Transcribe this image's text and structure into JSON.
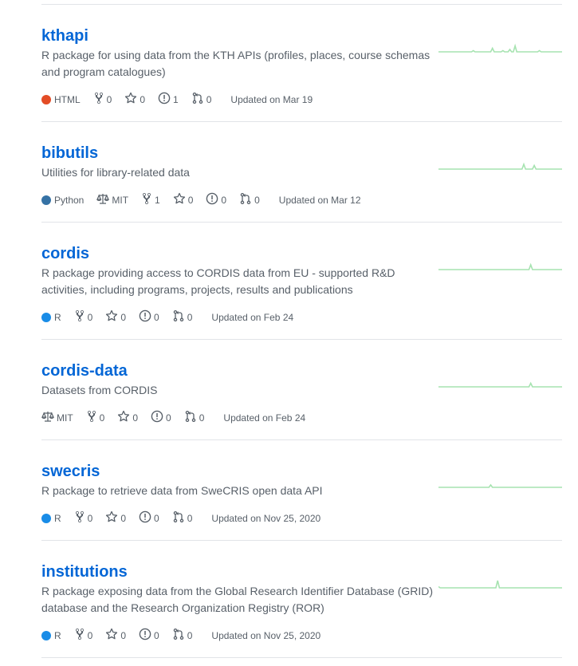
{
  "repos": [
    {
      "name": "kthapi",
      "description": "R package for using data from the KTH APIs (profiles, places, course schemas and program catalogues)",
      "language": "HTML",
      "language_color": "#e34c26",
      "license": null,
      "forks": "0",
      "stars": "0",
      "issues": "1",
      "pulls": "0",
      "updated": "Updated on Mar 19",
      "activity": [
        0,
        0,
        0,
        0,
        0,
        0,
        0,
        0,
        0,
        0,
        0,
        0,
        0,
        0,
        0,
        0,
        0,
        0,
        0,
        0,
        1,
        0,
        0,
        0,
        0,
        0,
        0,
        0,
        0,
        0,
        0,
        3,
        0,
        0,
        0,
        0,
        0,
        1,
        0,
        0,
        0,
        2,
        0,
        0,
        5,
        0,
        0,
        0,
        0,
        0,
        0,
        0,
        0,
        0,
        0,
        0,
        0,
        0,
        1,
        0,
        0,
        0,
        0,
        0,
        0,
        0,
        0,
        0,
        0,
        0,
        0,
        0
      ]
    },
    {
      "name": "bibutils",
      "description": "Utilities for library-related data",
      "language": "Python",
      "language_color": "#3572a5",
      "license": "MIT",
      "forks": "1",
      "stars": "0",
      "issues": "0",
      "pulls": "0",
      "updated": "Updated on Mar 12",
      "activity": [
        0,
        0,
        0,
        0,
        0,
        0,
        0,
        0,
        0,
        0,
        0,
        0,
        0,
        0,
        0,
        0,
        0,
        0,
        0,
        0,
        0,
        0,
        0,
        0,
        0,
        0,
        0,
        0,
        0,
        0,
        0,
        0,
        0,
        0,
        0,
        0,
        0,
        0,
        0,
        0,
        0,
        0,
        0,
        0,
        0,
        0,
        0,
        0,
        0,
        4,
        0,
        0,
        0,
        0,
        0,
        3,
        0,
        0,
        0,
        0,
        0,
        0,
        0,
        0,
        0,
        0,
        0,
        0,
        0,
        0,
        0,
        0
      ]
    },
    {
      "name": "cordis",
      "description": "R package providing access to CORDIS data from EU - supported R&D activities, including programs, projects, results and publications",
      "language": "R",
      "language_color": "#198ce7",
      "license": null,
      "forks": "0",
      "stars": "0",
      "issues": "0",
      "pulls": "0",
      "updated": "Updated on Feb 24",
      "activity": [
        0,
        0,
        0,
        0,
        0,
        0,
        0,
        0,
        0,
        0,
        0,
        0,
        0,
        0,
        0,
        0,
        0,
        0,
        0,
        0,
        0,
        0,
        0,
        0,
        0,
        0,
        0,
        0,
        0,
        0,
        0,
        0,
        0,
        0,
        0,
        0,
        0,
        0,
        0,
        0,
        0,
        0,
        0,
        0,
        0,
        0,
        0,
        0,
        0,
        0,
        0,
        0,
        0,
        4,
        0,
        0,
        0,
        0,
        0,
        0,
        0,
        0,
        0,
        0,
        0,
        0,
        0,
        0,
        0,
        0,
        0,
        0
      ]
    },
    {
      "name": "cordis-data",
      "description": "Datasets from CORDIS",
      "language": null,
      "language_color": null,
      "license": "MIT",
      "forks": "0",
      "stars": "0",
      "issues": "0",
      "pulls": "0",
      "updated": "Updated on Feb 24",
      "activity": [
        0,
        0,
        0,
        0,
        0,
        0,
        0,
        0,
        0,
        0,
        0,
        0,
        0,
        0,
        0,
        0,
        0,
        0,
        0,
        0,
        0,
        0,
        0,
        0,
        0,
        0,
        0,
        0,
        0,
        0,
        0,
        0,
        0,
        0,
        0,
        0,
        0,
        0,
        0,
        0,
        0,
        0,
        0,
        0,
        0,
        0,
        0,
        0,
        0,
        0,
        0,
        0,
        0,
        3,
        0,
        0,
        0,
        0,
        0,
        0,
        0,
        0,
        0,
        0,
        0,
        0,
        0,
        0,
        0,
        0,
        0,
        0
      ]
    },
    {
      "name": "swecris",
      "description": "R package to retrieve data from SweCRIS open data API",
      "language": "R",
      "language_color": "#198ce7",
      "license": null,
      "forks": "0",
      "stars": "0",
      "issues": "0",
      "pulls": "0",
      "updated": "Updated on Nov 25, 2020",
      "activity": [
        0,
        0,
        0,
        0,
        0,
        0,
        0,
        0,
        0,
        0,
        0,
        0,
        0,
        0,
        0,
        0,
        0,
        0,
        0,
        0,
        0,
        0,
        0,
        0,
        0,
        0,
        0,
        0,
        0,
        0,
        2,
        0,
        0,
        0,
        0,
        0,
        0,
        0,
        0,
        0,
        0,
        0,
        0,
        0,
        0,
        0,
        0,
        0,
        0,
        0,
        0,
        0,
        0,
        0,
        0,
        0,
        0,
        0,
        0,
        0,
        0,
        0,
        0,
        0,
        0,
        0,
        0,
        0,
        0,
        0,
        0,
        0
      ]
    },
    {
      "name": "institutions",
      "description": "R package exposing data from the Global Research Identifier Database (GRID) database and the Research Organization Registry (ROR)",
      "language": "R",
      "language_color": "#198ce7",
      "license": null,
      "forks": "0",
      "stars": "0",
      "issues": "0",
      "pulls": "0",
      "updated": "Updated on Nov 25, 2020",
      "activity": [
        1,
        0,
        0,
        0,
        0,
        0,
        0,
        0,
        0,
        0,
        0,
        0,
        0,
        0,
        0,
        0,
        0,
        0,
        0,
        0,
        0,
        0,
        0,
        0,
        0,
        0,
        0,
        0,
        0,
        0,
        0,
        0,
        0,
        0,
        6,
        0,
        0,
        0,
        0,
        0,
        0,
        0,
        0,
        0,
        0,
        0,
        0,
        0,
        0,
        0,
        0,
        0,
        0,
        0,
        0,
        0,
        0,
        0,
        0,
        0,
        0,
        0,
        0,
        0,
        0,
        0,
        0,
        0,
        0,
        0,
        0,
        0
      ]
    }
  ],
  "colors": {
    "link": "#0366d6",
    "muted": "#586069",
    "spark": "#a6e3b0",
    "border": "#e1e4e8"
  }
}
